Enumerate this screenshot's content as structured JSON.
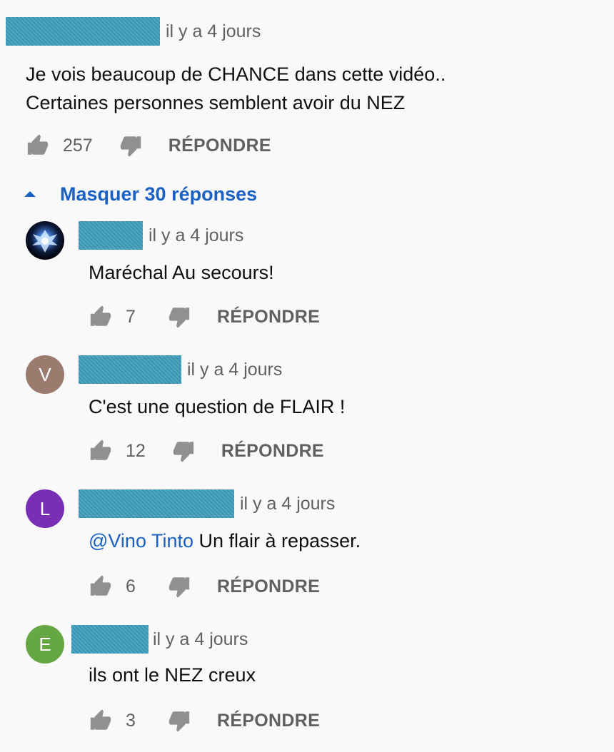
{
  "comments": {
    "top": {
      "time": "il y a 4 jours",
      "text_line1": "Je vois beaucoup de CHANCE dans cette vidéo..",
      "text_line2": "Certaines personnes semblent avoir du NEZ",
      "likes": "257",
      "reply_label": "RÉPONDRE"
    },
    "toggle_label": "Masquer 30 réponses",
    "replies": [
      {
        "avatar_letter": "",
        "avatar_color": "#0b1633",
        "time": "il y a 4 jours",
        "mention": "",
        "text": "Maréchal Au secours!",
        "likes": "7",
        "reply_label": "RÉPONDRE"
      },
      {
        "avatar_letter": "V",
        "avatar_color": "#9b7b6d",
        "time": "il y a 4 jours",
        "mention": "",
        "text": "C'est une question de FLAIR !",
        "likes": "12",
        "reply_label": "RÉPONDRE"
      },
      {
        "avatar_letter": "L",
        "avatar_color": "#7a2db5",
        "time": "il y a 4 jours",
        "mention": "@Vino Tinto",
        "text": "Un flair à repasser.",
        "likes": "6",
        "reply_label": "RÉPONDRE"
      },
      {
        "avatar_letter": "E",
        "avatar_color": "#65a843",
        "time": "il y a 4 jours",
        "mention": "",
        "text": "ils ont le NEZ creux",
        "likes": "3",
        "reply_label": "RÉPONDRE"
      }
    ]
  },
  "colors": {
    "link": "#1a61c6",
    "meta": "#606060",
    "redaction": "#3c9dbc"
  }
}
